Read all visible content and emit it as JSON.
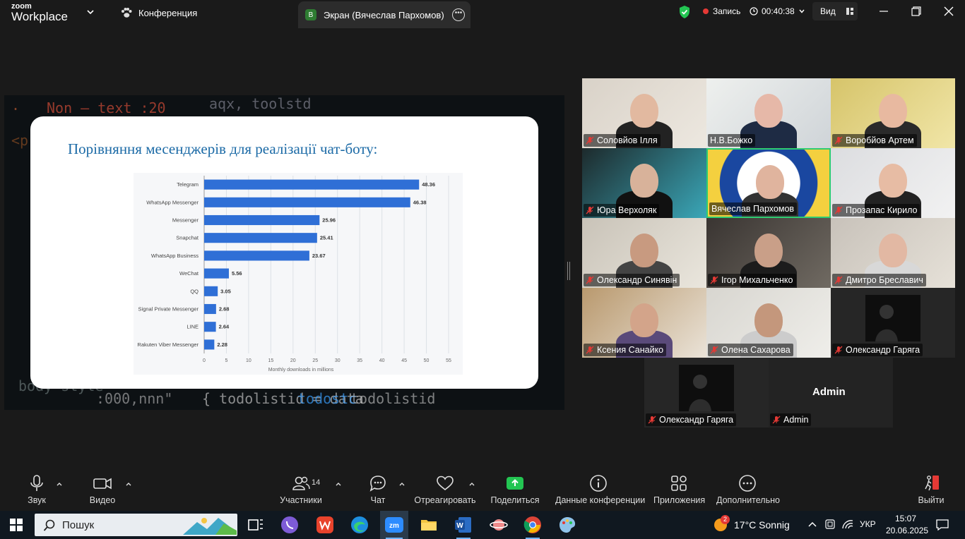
{
  "topbar": {
    "logo_line1": "zoom",
    "logo_line2": "Workplace",
    "conference_label": "Конференция",
    "screen_tab_avatar": "В",
    "screen_tab_label": "Экран (Вячеслав Пархомов)",
    "recording_label": "Запись",
    "timer": "00:40:38",
    "view_label": "Вид"
  },
  "slide": {
    "title": "Порівняння месенджерів для реалізації чат-боту:"
  },
  "chart_data": {
    "type": "bar",
    "orientation": "horizontal",
    "categories": [
      "Telegram",
      "WhatsApp Messenger",
      "Messenger",
      "Snapchat",
      "WhatsApp Business",
      "WeChat",
      "QQ",
      "Signal Private Messenger",
      "LINE",
      "Rakuten Viber Messenger"
    ],
    "values": [
      48.36,
      46.38,
      25.96,
      25.41,
      23.67,
      5.56,
      3.05,
      2.68,
      2.64,
      2.28
    ],
    "value_labels": [
      "48.36",
      "46.38",
      "25.96",
      "25.41",
      "23.67",
      "5.56",
      "3.05",
      "2.68",
      "2.64",
      "2.28"
    ],
    "xticks": [
      "0",
      "5",
      "10",
      "15",
      "20",
      "25",
      "30",
      "35",
      "40",
      "45",
      "50",
      "55"
    ],
    "xlim": [
      0,
      55
    ],
    "xlabel": "Monthly downloads in millions",
    "bar_color": "#2f6fd6",
    "grid": true
  },
  "participants": [
    {
      "name": "Соловйов Ілля",
      "muted": true
    },
    {
      "name": "Н.В.Божко",
      "muted": false
    },
    {
      "name": "Воробйов Артем",
      "muted": true
    },
    {
      "name": "Юра Верхоляк",
      "muted": true
    },
    {
      "name": "Вячеслав Пархомов",
      "muted": false,
      "active": true
    },
    {
      "name": "Прозапас Кирило",
      "muted": true
    },
    {
      "name": "Олександр Синявін",
      "muted": true
    },
    {
      "name": "Ігор Михальченко",
      "muted": true
    },
    {
      "name": "Дмитро Бреславич",
      "muted": true
    },
    {
      "name": "Ксения Санайко",
      "muted": true
    },
    {
      "name": "Олена Сахарова",
      "muted": true
    },
    {
      "name": "Олександр Гаряга",
      "muted": true
    }
  ],
  "extra_tiles": {
    "left_name": "Олександр Гаряга",
    "admin_name": "Admin",
    "admin_display": "Admin"
  },
  "toolbar": {
    "audio": "Звук",
    "video": "Видео",
    "participants": "Участники",
    "participants_count": "14",
    "chat": "Чат",
    "react": "Отреагировать",
    "share": "Поделиться",
    "meeting_info": "Данные конференции",
    "apps": "Приложения",
    "more": "Дополнительно",
    "leave": "Выйти"
  },
  "taskbar": {
    "search_label": "Пошук",
    "weather_badge": "2",
    "weather_text": "17°C  Sonnig",
    "language": "УКР",
    "time": "15:07",
    "date": "20.06.2025"
  }
}
